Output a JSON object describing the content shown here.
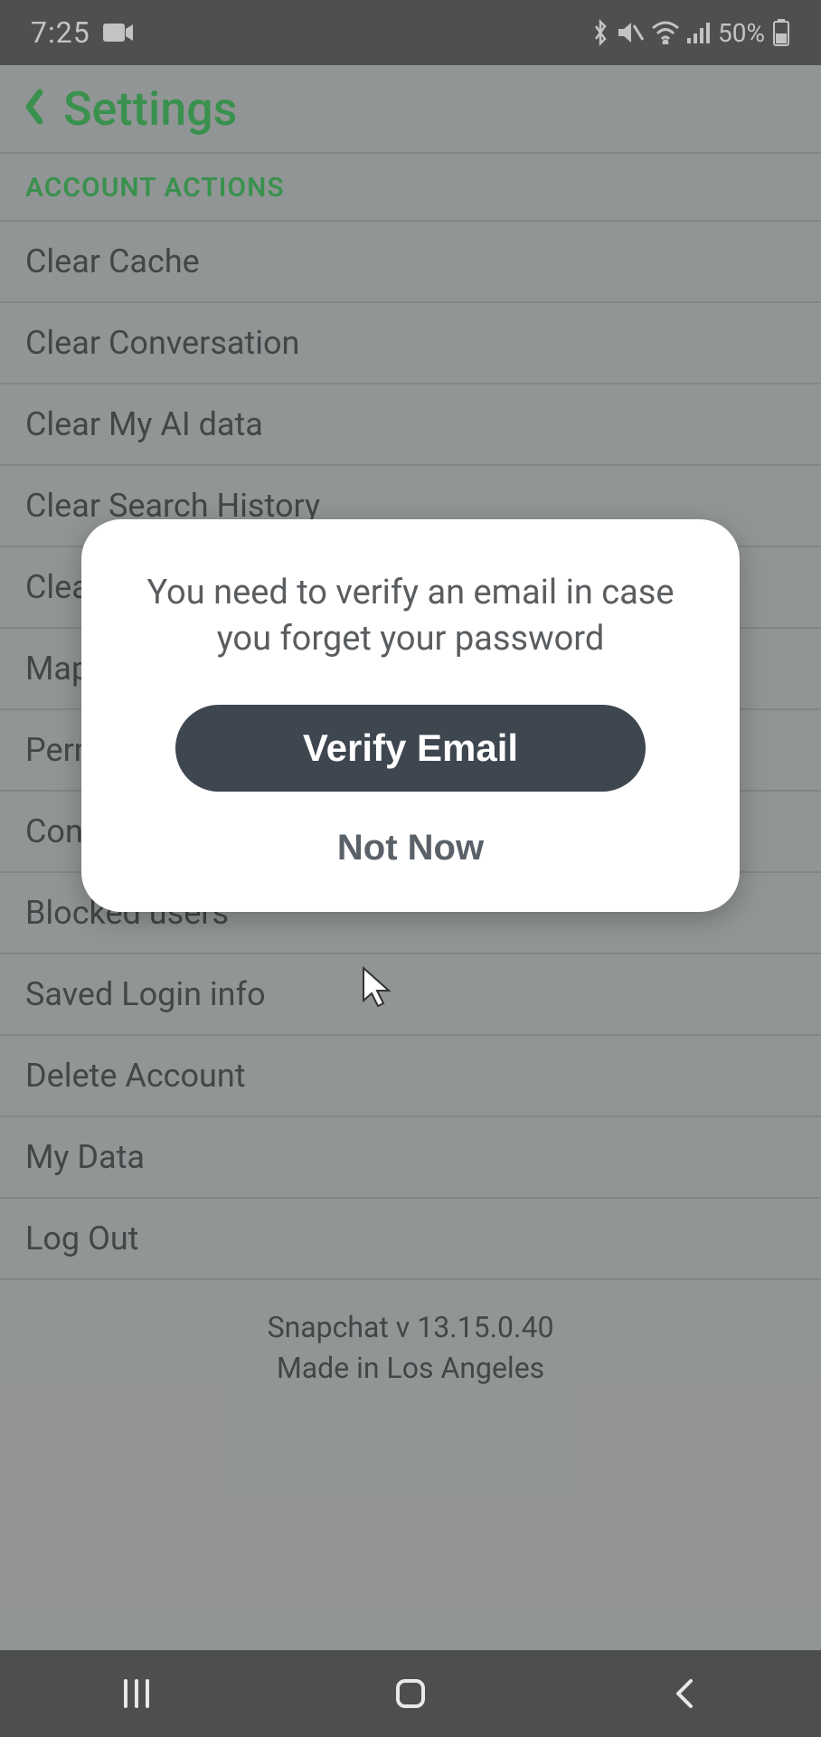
{
  "status": {
    "clock": "7:25",
    "battery_text": "50%"
  },
  "header": {
    "title": "Settings"
  },
  "section": {
    "title": "ACCOUNT ACTIONS"
  },
  "items": [
    "Clear Cache",
    "Clear Conversation",
    "Clear My AI data",
    "Clear Search History",
    "Clear Top Locations",
    "Map",
    "Permissions",
    "Contact Me",
    "Blocked users",
    "Saved Login info",
    "Delete Account",
    "My Data",
    "Log Out"
  ],
  "footer": {
    "version": "Snapchat v 13.15.0.40",
    "madein": "Made in Los Angeles"
  },
  "dialog": {
    "message": "You need to verify an email in case you forget your password",
    "primary": "Verify Email",
    "secondary": "Not Now"
  }
}
